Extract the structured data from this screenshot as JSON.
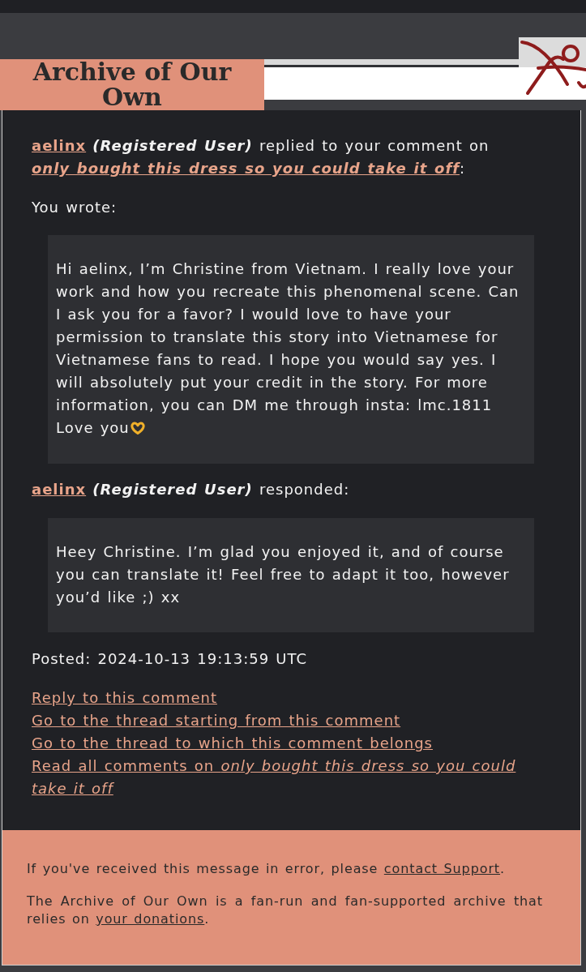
{
  "header": {
    "title": "Archive of Our Own"
  },
  "notice": {
    "user": "aelinx",
    "role": "(Registered User)",
    "action": "replied to your comment on",
    "work_title": "only bought this dress so you could take it off",
    "suffix": ":"
  },
  "original_comment": {
    "label": "You wrote:",
    "text": "Hi aelinx, I’m Christine from Vietnam. I really love your work and how you recreate this phenomenal scene. Can I ask you for a favor? I would love to have your permission to translate this story into Vietnamese for Vietnamese fans to read. I hope you would say yes. I will absolutely put your credit in the story. For more information, you can DM me through insta: lmc.1811",
    "sign_off": "Love you"
  },
  "response": {
    "user": "aelinx",
    "role": "(Registered User)",
    "action": "responded:",
    "text": "Heey Christine. I’m glad you enjoyed it, and of course you can translate it! Feel free to adapt it too, however you’d like ;) xx"
  },
  "posted": "Posted: 2024-10-13 19:13:59 UTC",
  "actions": [
    {
      "label": "Reply to this comment"
    },
    {
      "label": "Go to the thread starting from this comment"
    },
    {
      "label": "Go to the thread to which this comment belongs"
    },
    {
      "label": "Read all comments on *only bought this dress so you could take it off*"
    }
  ],
  "footer": {
    "paragraphs": [
      {
        "before": "If you've received this message in error, please",
        "link": "contact Support",
        "after": "."
      },
      {
        "before": "The Archive of Our Own is a fan-run and fan-supported archive that relies on",
        "link": "your donations",
        "after": "."
      }
    ]
  }
}
